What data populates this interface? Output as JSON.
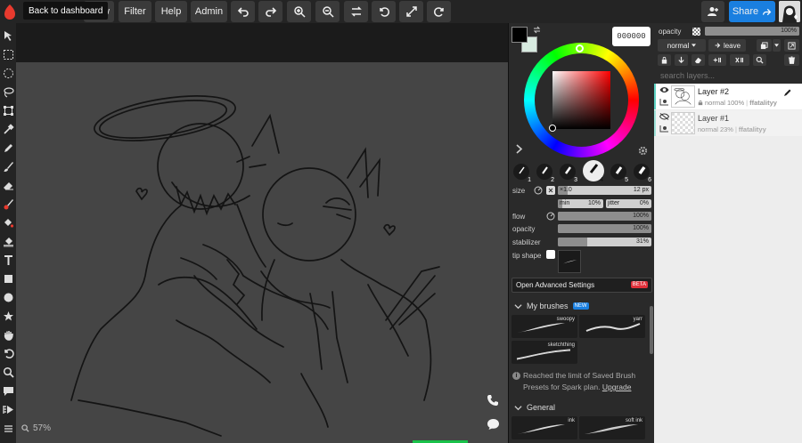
{
  "topbar": {
    "tooltip": "Back to dashboard",
    "view_partial": "ew",
    "filter_label": "Filter",
    "help_label": "Help",
    "admin_label": "Admin",
    "share_label": "Share"
  },
  "canvas": {
    "zoom": "57%"
  },
  "color": {
    "hex": "000000",
    "primary": "#000000",
    "secondary": "#d8ebe0"
  },
  "brush": {
    "sizes": [
      "1",
      "2",
      "3",
      "4",
      "5",
      "6"
    ],
    "size_label": "size",
    "multiplier": "×1.0",
    "size_value": "12 px",
    "min_label": "min",
    "min_value": "10%",
    "jitter_label": "jitter",
    "jitter_value": "0%",
    "flow_label": "flow",
    "flow_value": "100%",
    "opacity_label": "opacity",
    "opacity_value": "100%",
    "stabilizer_label": "stabilizer",
    "stabilizer_value": "31%",
    "stabilizer_level": 0.31,
    "tip_shape_label": "tip shape",
    "advanced_label": "Open Advanced Settings",
    "beta_badge": "BETA",
    "my_brushes_label": "My brushes",
    "new_badge": "NEW",
    "my_presets": [
      "swoopy",
      "yarr",
      "sketchthing"
    ],
    "limit_text": "Reached the limit of Saved Brush Presets for Spark plan.",
    "upgrade_label": "Upgrade",
    "general_label": "General",
    "general_presets": [
      "ink",
      "soft ink"
    ]
  },
  "layers_panel": {
    "opacity_label": "opacity",
    "opacity_value": "100%",
    "blend_mode": "normal",
    "leave_label": "leave",
    "search_placeholder": "search layers...",
    "layers": [
      {
        "name": "Layer #2",
        "mode": "normal",
        "opacity": "100%",
        "owner": "ffatalityy"
      },
      {
        "name": "Layer #1",
        "mode": "normal",
        "opacity": "23%",
        "owner": "ffatalityy"
      }
    ]
  },
  "colors": {
    "accent": "#1a7fe0",
    "layer_highlight": "#5fd3c4",
    "canvas_bg": "#454545",
    "logo_red": "#e83a2e"
  }
}
